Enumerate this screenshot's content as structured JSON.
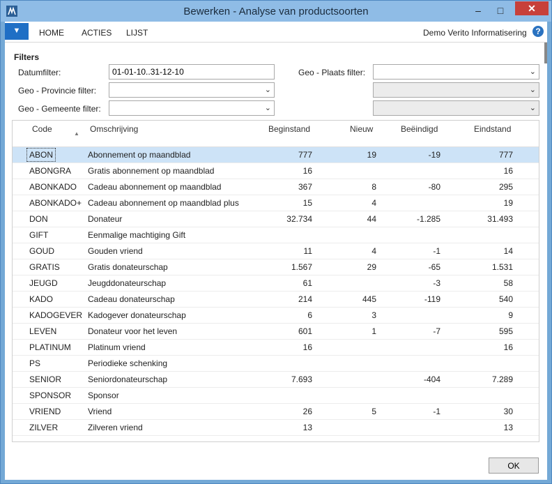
{
  "window": {
    "title": "Bewerken - Analyse van productsoorten",
    "minimize": "–",
    "maximize": "□",
    "close": "✕"
  },
  "ribbon": {
    "menu_glyph": "▼",
    "tabs": [
      "HOME",
      "ACTIES",
      "LIJST"
    ],
    "company": "Demo Verito Informatisering",
    "help": "?"
  },
  "filters": {
    "title": "Filters",
    "date_label": "Datumfilter:",
    "date_value": "01-01-10..31-12-10",
    "province_label": "Geo - Provincie filter:",
    "municipality_label": "Geo - Gemeente filter:",
    "place_label": "Geo - Plaats filter:"
  },
  "table": {
    "headers": [
      "Code",
      "Omschrijving",
      "Beginstand",
      "Nieuw",
      "Beëindigd",
      "Eindstand"
    ],
    "rows": [
      [
        "ABON",
        "Abonnement op maandblad",
        "777",
        "19",
        "-19",
        "777"
      ],
      [
        "ABONGRA",
        "Gratis abonnement op maandblad",
        "16",
        "",
        "",
        "16"
      ],
      [
        "ABONKADO",
        "Cadeau abonnement op maandblad",
        "367",
        "8",
        "-80",
        "295"
      ],
      [
        "ABONKADO+",
        "Cadeau abonnement op maandblad plus",
        "15",
        "4",
        "",
        "19"
      ],
      [
        "DON",
        "Donateur",
        "32.734",
        "44",
        "-1.285",
        "31.493"
      ],
      [
        "GIFT",
        "Eenmalige machtiging Gift",
        "",
        "",
        "",
        ""
      ],
      [
        "GOUD",
        "Gouden vriend",
        "11",
        "4",
        "-1",
        "14"
      ],
      [
        "GRATIS",
        "Gratis donateurschap",
        "1.567",
        "29",
        "-65",
        "1.531"
      ],
      [
        "JEUGD",
        "Jeugddonateurschap",
        "61",
        "",
        "-3",
        "58"
      ],
      [
        "KADO",
        "Cadeau donateurschap",
        "214",
        "445",
        "-119",
        "540"
      ],
      [
        "KADOGEVER",
        "Kadogever donateurschap",
        "6",
        "3",
        "",
        "9"
      ],
      [
        "LEVEN",
        "Donateur voor het leven",
        "601",
        "1",
        "-7",
        "595"
      ],
      [
        "PLATINUM",
        "Platinum vriend",
        "16",
        "",
        "",
        "16"
      ],
      [
        "PS",
        "Periodieke schenking",
        "",
        "",
        "",
        ""
      ],
      [
        "SENIOR",
        "Seniordonateurschap",
        "7.693",
        "",
        "-404",
        "7.289"
      ],
      [
        "SPONSOR",
        "Sponsor",
        "",
        "",
        "",
        ""
      ],
      [
        "VRIEND",
        "Vriend",
        "26",
        "5",
        "-1",
        "30"
      ],
      [
        "ZILVER",
        "Zilveren vriend",
        "13",
        "",
        "",
        "13"
      ]
    ]
  },
  "ok_label": "OK"
}
